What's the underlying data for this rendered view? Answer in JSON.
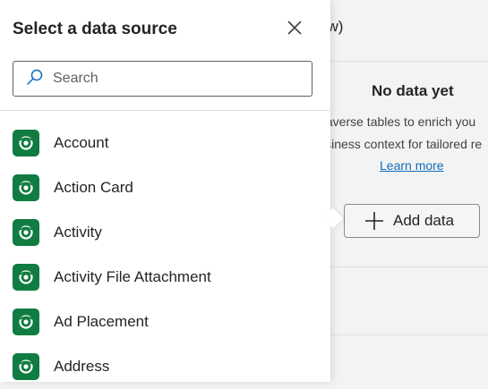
{
  "background": {
    "title_fragment": "ew)",
    "empty_state": {
      "heading": "No data yet",
      "line1": "taverse tables to enrich you",
      "line2": "isiness context for tailored re",
      "learn_more": "Learn more"
    },
    "add_button_label": "Add data"
  },
  "panel": {
    "title": "Select a data source",
    "search": {
      "placeholder": "Search",
      "value": ""
    },
    "items": [
      {
        "label": "Account",
        "icon": "dataverse-icon"
      },
      {
        "label": "Action Card",
        "icon": "dataverse-icon"
      },
      {
        "label": "Activity",
        "icon": "dataverse-icon"
      },
      {
        "label": "Activity File Attachment",
        "icon": "dataverse-icon"
      },
      {
        "label": "Ad Placement",
        "icon": "dataverse-icon"
      },
      {
        "label": "Address",
        "icon": "dataverse-icon"
      }
    ]
  },
  "colors": {
    "dataverse_green": "#107c41",
    "link_blue": "#0f6cbd"
  }
}
